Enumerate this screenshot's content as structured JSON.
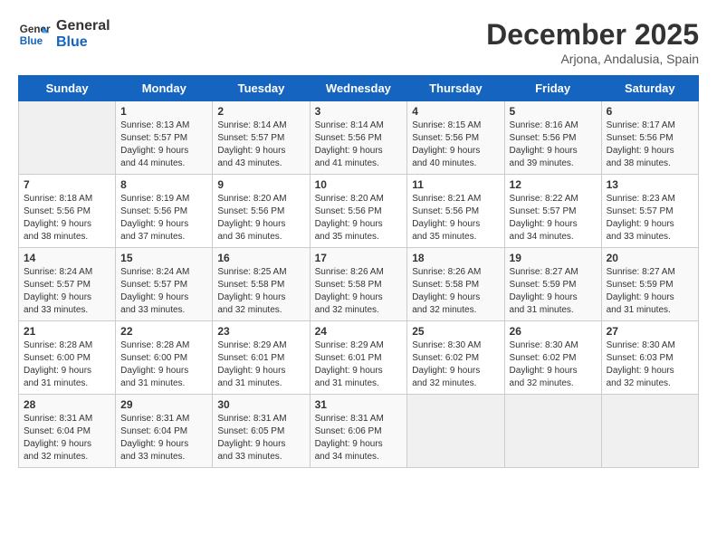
{
  "logo": {
    "line1": "General",
    "line2": "Blue"
  },
  "title": "December 2025",
  "location": "Arjona, Andalusia, Spain",
  "days_of_week": [
    "Sunday",
    "Monday",
    "Tuesday",
    "Wednesday",
    "Thursday",
    "Friday",
    "Saturday"
  ],
  "weeks": [
    [
      {
        "day": "",
        "info": ""
      },
      {
        "day": "1",
        "info": "Sunrise: 8:13 AM\nSunset: 5:57 PM\nDaylight: 9 hours\nand 44 minutes."
      },
      {
        "day": "2",
        "info": "Sunrise: 8:14 AM\nSunset: 5:57 PM\nDaylight: 9 hours\nand 43 minutes."
      },
      {
        "day": "3",
        "info": "Sunrise: 8:14 AM\nSunset: 5:56 PM\nDaylight: 9 hours\nand 41 minutes."
      },
      {
        "day": "4",
        "info": "Sunrise: 8:15 AM\nSunset: 5:56 PM\nDaylight: 9 hours\nand 40 minutes."
      },
      {
        "day": "5",
        "info": "Sunrise: 8:16 AM\nSunset: 5:56 PM\nDaylight: 9 hours\nand 39 minutes."
      },
      {
        "day": "6",
        "info": "Sunrise: 8:17 AM\nSunset: 5:56 PM\nDaylight: 9 hours\nand 38 minutes."
      }
    ],
    [
      {
        "day": "7",
        "info": "Sunrise: 8:18 AM\nSunset: 5:56 PM\nDaylight: 9 hours\nand 38 minutes."
      },
      {
        "day": "8",
        "info": "Sunrise: 8:19 AM\nSunset: 5:56 PM\nDaylight: 9 hours\nand 37 minutes."
      },
      {
        "day": "9",
        "info": "Sunrise: 8:20 AM\nSunset: 5:56 PM\nDaylight: 9 hours\nand 36 minutes."
      },
      {
        "day": "10",
        "info": "Sunrise: 8:20 AM\nSunset: 5:56 PM\nDaylight: 9 hours\nand 35 minutes."
      },
      {
        "day": "11",
        "info": "Sunrise: 8:21 AM\nSunset: 5:56 PM\nDaylight: 9 hours\nand 35 minutes."
      },
      {
        "day": "12",
        "info": "Sunrise: 8:22 AM\nSunset: 5:57 PM\nDaylight: 9 hours\nand 34 minutes."
      },
      {
        "day": "13",
        "info": "Sunrise: 8:23 AM\nSunset: 5:57 PM\nDaylight: 9 hours\nand 33 minutes."
      }
    ],
    [
      {
        "day": "14",
        "info": "Sunrise: 8:24 AM\nSunset: 5:57 PM\nDaylight: 9 hours\nand 33 minutes."
      },
      {
        "day": "15",
        "info": "Sunrise: 8:24 AM\nSunset: 5:57 PM\nDaylight: 9 hours\nand 33 minutes."
      },
      {
        "day": "16",
        "info": "Sunrise: 8:25 AM\nSunset: 5:58 PM\nDaylight: 9 hours\nand 32 minutes."
      },
      {
        "day": "17",
        "info": "Sunrise: 8:26 AM\nSunset: 5:58 PM\nDaylight: 9 hours\nand 32 minutes."
      },
      {
        "day": "18",
        "info": "Sunrise: 8:26 AM\nSunset: 5:58 PM\nDaylight: 9 hours\nand 32 minutes."
      },
      {
        "day": "19",
        "info": "Sunrise: 8:27 AM\nSunset: 5:59 PM\nDaylight: 9 hours\nand 31 minutes."
      },
      {
        "day": "20",
        "info": "Sunrise: 8:27 AM\nSunset: 5:59 PM\nDaylight: 9 hours\nand 31 minutes."
      }
    ],
    [
      {
        "day": "21",
        "info": "Sunrise: 8:28 AM\nSunset: 6:00 PM\nDaylight: 9 hours\nand 31 minutes."
      },
      {
        "day": "22",
        "info": "Sunrise: 8:28 AM\nSunset: 6:00 PM\nDaylight: 9 hours\nand 31 minutes."
      },
      {
        "day": "23",
        "info": "Sunrise: 8:29 AM\nSunset: 6:01 PM\nDaylight: 9 hours\nand 31 minutes."
      },
      {
        "day": "24",
        "info": "Sunrise: 8:29 AM\nSunset: 6:01 PM\nDaylight: 9 hours\nand 31 minutes."
      },
      {
        "day": "25",
        "info": "Sunrise: 8:30 AM\nSunset: 6:02 PM\nDaylight: 9 hours\nand 32 minutes."
      },
      {
        "day": "26",
        "info": "Sunrise: 8:30 AM\nSunset: 6:02 PM\nDaylight: 9 hours\nand 32 minutes."
      },
      {
        "day": "27",
        "info": "Sunrise: 8:30 AM\nSunset: 6:03 PM\nDaylight: 9 hours\nand 32 minutes."
      }
    ],
    [
      {
        "day": "28",
        "info": "Sunrise: 8:31 AM\nSunset: 6:04 PM\nDaylight: 9 hours\nand 32 minutes."
      },
      {
        "day": "29",
        "info": "Sunrise: 8:31 AM\nSunset: 6:04 PM\nDaylight: 9 hours\nand 33 minutes."
      },
      {
        "day": "30",
        "info": "Sunrise: 8:31 AM\nSunset: 6:05 PM\nDaylight: 9 hours\nand 33 minutes."
      },
      {
        "day": "31",
        "info": "Sunrise: 8:31 AM\nSunset: 6:06 PM\nDaylight: 9 hours\nand 34 minutes."
      },
      {
        "day": "",
        "info": ""
      },
      {
        "day": "",
        "info": ""
      },
      {
        "day": "",
        "info": ""
      }
    ]
  ]
}
